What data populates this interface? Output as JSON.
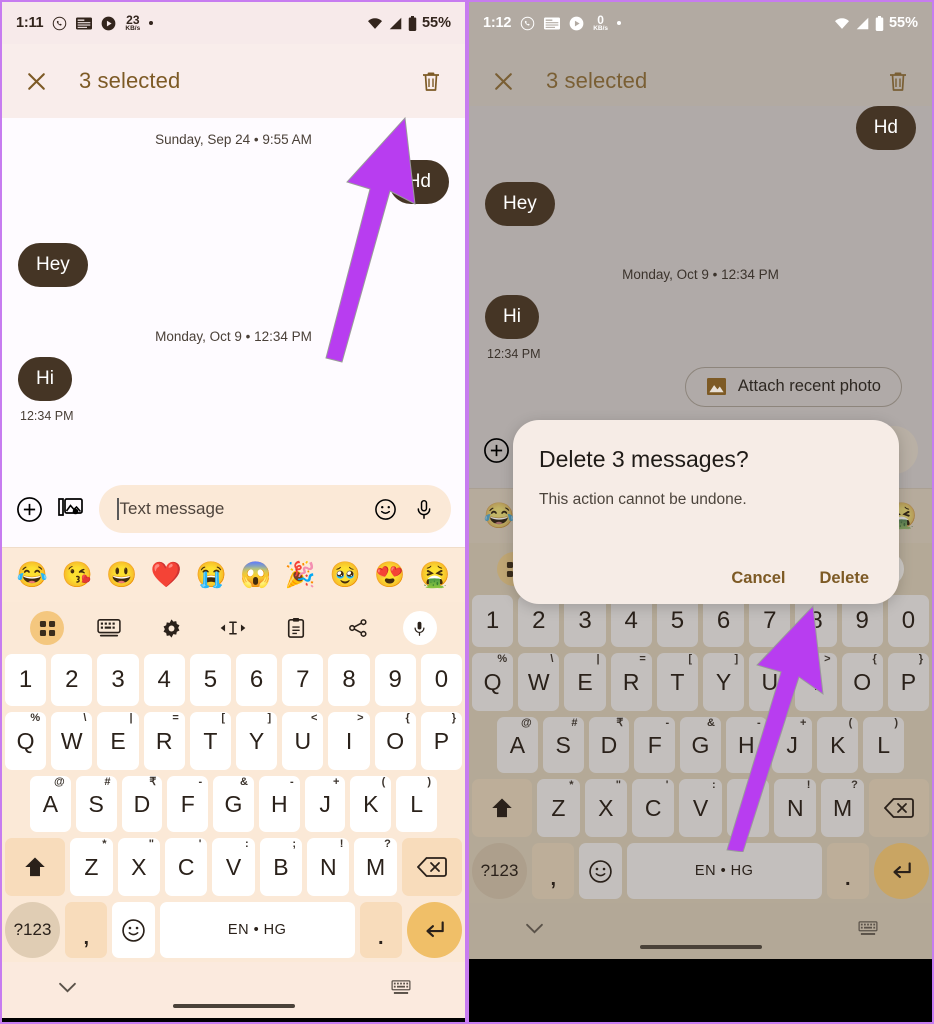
{
  "left": {
    "statusbar": {
      "time": "1:11",
      "icons": [
        "whatsapp-icon",
        "news-icon",
        "play-icon"
      ],
      "net_rate_value": "23",
      "net_rate_unit": "KB/s",
      "wifi": "wifi-icon",
      "signal": "signal-icon",
      "battery": "battery-icon",
      "battery_pct": "55%"
    },
    "appbar": {
      "close_label": "close-icon",
      "title": "3 selected",
      "delete_label": "delete-icon"
    },
    "chat": {
      "daystamp1": "Sunday, Sep 24 • 9:55 AM",
      "msg_out1": "Hd",
      "msg_in1": "Hey",
      "daystamp2": "Monday, Oct 9 • 12:34 PM",
      "msg_in2": "Hi",
      "msgtime": "12:34 PM"
    },
    "composer": {
      "add_icon": "plus-circle-icon",
      "gallery_icon": "gallery-icon",
      "placeholder": "Text message",
      "emoji_icon": "emoji-icon",
      "mic_icon": "microphone-icon"
    },
    "navbar": {
      "collapse": "chevron-down-icon",
      "keyboard": "keyboard-switch-icon"
    }
  },
  "right": {
    "statusbar": {
      "time": "1:12",
      "net_rate_value": "0",
      "net_rate_unit": "KB/s",
      "battery_pct": "55%"
    },
    "appbar": {
      "title": "3 selected"
    },
    "chat": {
      "msg_out1": "Hd",
      "msg_in1": "Hey",
      "daystamp2": "Monday, Oct 9 • 12:34 PM",
      "msg_in2": "Hi",
      "msgtime": "12:34 PM",
      "chip_label": "Attach recent photo",
      "chip_icon": "image-icon"
    },
    "dialog": {
      "title": "Delete 3 messages?",
      "body": "This action cannot be undone.",
      "cancel": "Cancel",
      "confirm": "Delete"
    }
  },
  "emoji_strip": [
    "😂",
    "😘",
    "😃",
    "❤️",
    "😭",
    "😱",
    "🎉",
    "🥹",
    "😍",
    "🤮"
  ],
  "keyboard": {
    "toolbar": [
      "apps-grid-icon",
      "keyboard-icon",
      "gear-icon",
      "text-cursor-icon",
      "clipboard-icon",
      "share-icon",
      "microphone-icon"
    ],
    "row_num": [
      {
        "k": "1"
      },
      {
        "k": "2"
      },
      {
        "k": "3"
      },
      {
        "k": "4"
      },
      {
        "k": "5"
      },
      {
        "k": "6"
      },
      {
        "k": "7"
      },
      {
        "k": "8"
      },
      {
        "k": "9"
      },
      {
        "k": "0"
      }
    ],
    "row_q": [
      {
        "k": "Q",
        "s": "%"
      },
      {
        "k": "W",
        "s": "\\"
      },
      {
        "k": "E",
        "s": "|"
      },
      {
        "k": "R",
        "s": "="
      },
      {
        "k": "T",
        "s": "["
      },
      {
        "k": "Y",
        "s": "]"
      },
      {
        "k": "U",
        "s": "<"
      },
      {
        "k": "I",
        "s": ">"
      },
      {
        "k": "O",
        "s": "{"
      },
      {
        "k": "P",
        "s": "}"
      }
    ],
    "row_a": [
      {
        "k": "A",
        "s": "@"
      },
      {
        "k": "S",
        "s": "#"
      },
      {
        "k": "D",
        "s": "₹"
      },
      {
        "k": "F",
        "s": "-"
      },
      {
        "k": "G",
        "s": "&"
      },
      {
        "k": "H",
        "s": "-"
      },
      {
        "k": "J",
        "s": "+"
      },
      {
        "k": "K",
        "s": "("
      },
      {
        "k": "L",
        "s": ")"
      }
    ],
    "row_z": [
      {
        "k": "Z",
        "s": "*"
      },
      {
        "k": "X",
        "s": "\""
      },
      {
        "k": "C",
        "s": "'"
      },
      {
        "k": "V",
        "s": ":"
      },
      {
        "k": "B",
        "s": ";"
      },
      {
        "k": "N",
        "s": "!"
      },
      {
        "k": "M",
        "s": "?"
      }
    ],
    "shift": "shift-icon",
    "backspace": "backspace-icon",
    "sym": "?123",
    "comma": ",",
    "emoji": "emoji-icon",
    "space": "EN • HG",
    "period": ".",
    "enter": "enter-icon"
  },
  "colors": {
    "accent_purple": "#b83df0",
    "brand_gold": "#7d5a25",
    "bubble": "#453525"
  }
}
